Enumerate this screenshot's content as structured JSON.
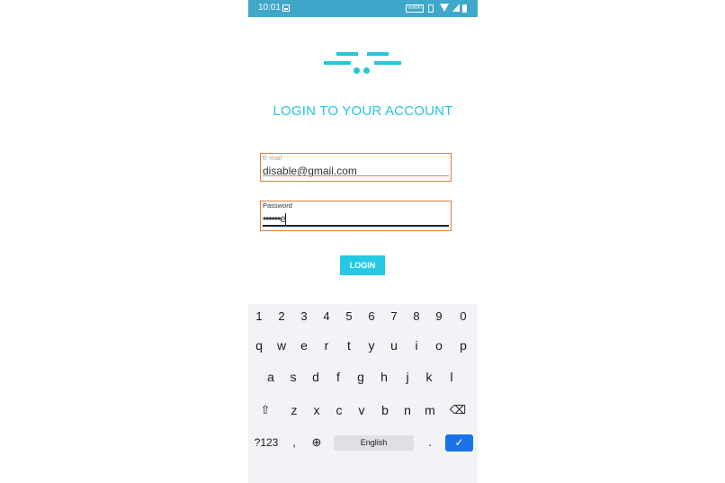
{
  "status_bar": {
    "time": "10:01",
    "vowifi_label": "VoWiFi"
  },
  "page": {
    "title": "LOGIN TO YOUR ACCOUNT"
  },
  "email": {
    "label": "E-mail",
    "value": "disable@gmail.com"
  },
  "password": {
    "label": "Password",
    "value": "••••••e"
  },
  "login_button": {
    "label": "LOGIN"
  },
  "keyboard": {
    "numbers": [
      "1",
      "2",
      "3",
      "4",
      "5",
      "6",
      "7",
      "8",
      "9",
      "0"
    ],
    "row1": [
      "q",
      "w",
      "e",
      "r",
      "t",
      "y",
      "u",
      "i",
      "o",
      "p"
    ],
    "row2": [
      "a",
      "s",
      "d",
      "f",
      "g",
      "h",
      "j",
      "k",
      "l"
    ],
    "row3": [
      "z",
      "x",
      "c",
      "v",
      "b",
      "n",
      "m"
    ],
    "mode_switch": "?123",
    "comma": ",",
    "space_label": "English",
    "period": ".",
    "shift_glyph": "⇧",
    "backspace_glyph": "⌫",
    "globe_glyph": "⊕",
    "enter_glyph": "✓"
  },
  "colors": {
    "status_bar": "#3fa7c9",
    "accent": "#25c5dc",
    "field_border": "#e07b39",
    "keyboard_bg": "#f2f3f6",
    "enter_key": "#1a73e8"
  }
}
